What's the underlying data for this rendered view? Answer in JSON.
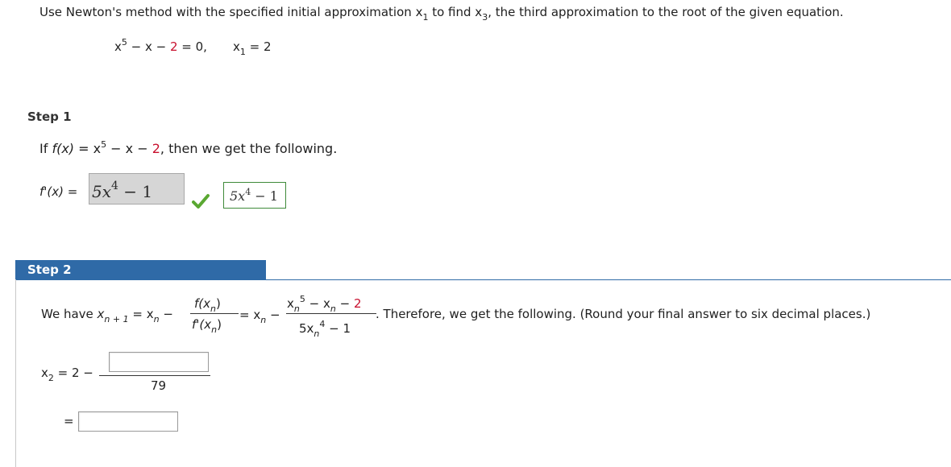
{
  "problem": {
    "prompt_pre": "Use Newton's method with the specified initial approximation ",
    "x1_base": "x",
    "x1_sub": "1",
    "prompt_mid": " to find ",
    "x3_base": "x",
    "x3_sub": "3",
    "prompt_post": ", the third approximation to the root of the given equation.",
    "eq_x": "x",
    "eq_pow": "5",
    "eq_rest": " − x − ",
    "eq_two": "2",
    "eq_zero": " = 0,",
    "init_base": "x",
    "init_sub": "1",
    "init_val": " = 2"
  },
  "step1": {
    "label": "Step 1",
    "text_pre": "If ",
    "fx": "f(x)",
    "eq": " = x",
    "pow": "5",
    "minus": " − x − ",
    "two": "2",
    "text_post": ", then we get the following.",
    "fprime_label": "f'(x) = ",
    "input_value": "5x",
    "input_pow": "4",
    "input_rest": " − 1",
    "check_icon": "check-icon",
    "correct_value": "5x",
    "correct_pow": "4",
    "correct_rest": " − 1"
  },
  "step2": {
    "label": "Step 2",
    "we_have": "We have ",
    "xn1_base": "x",
    "xn1_sub": "n + 1",
    "eq_xn": " = x",
    "eq_xn_sub": "n",
    "minus": " −",
    "f_num": "f(x",
    "f_num_sub": "n",
    "f_num_close": ")",
    "f_den": "f'(x",
    "f_den_sub": "n",
    "f_den_close": ")",
    "eq2_xn": "= x",
    "eq2_xn_sub": "n",
    "minus2": " −",
    "num_x": "x",
    "num_sub": "n",
    "num_pow": "5",
    "num_mid": " − x",
    "num_sub2": "n",
    "num_minus": " − ",
    "num_two": "2",
    "den_5x": "5x",
    "den_sub": "n",
    "den_pow": "4",
    "den_rest": " − 1",
    "therefore": ". Therefore, we get the following. (Round your final answer to six decimal places.)",
    "x2_base": "x",
    "x2_sub": "2",
    "x2_eq": " = 2 −",
    "denominator": "79",
    "equals": "="
  }
}
